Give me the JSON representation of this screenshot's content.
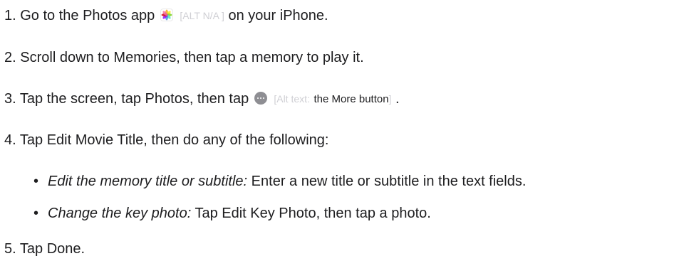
{
  "steps": [
    {
      "number": "1.",
      "before": "Go to the Photos app",
      "alt": "[ALT N/A ]",
      "after": "on your iPhone."
    },
    {
      "number": "2.",
      "text": "Scroll down to Memories, then tap a memory to play it."
    },
    {
      "number": "3.",
      "before": "Tap the screen, tap Photos, then tap",
      "alt_prefix": "[Alt text:",
      "alt_main": "the More button",
      "alt_suffix": "]",
      "after": "."
    },
    {
      "number": "4.",
      "text": "Tap Edit Movie Title, then do any of the following:"
    },
    {
      "number": "5.",
      "text": "Tap Done."
    }
  ],
  "bullets": [
    {
      "marker": "•",
      "label": "Edit the memory title or subtitle:",
      "text": "Enter a new title or subtitle in the text fields."
    },
    {
      "marker": "•",
      "label": "Change the key photo:",
      "text": "Tap Edit Key Photo, then tap a photo."
    }
  ],
  "icons": {
    "step1": "photos-app-icon",
    "step3": "more-button-icon"
  }
}
